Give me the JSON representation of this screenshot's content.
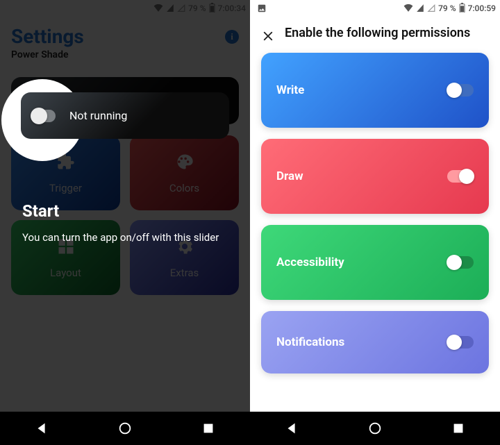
{
  "left": {
    "status": {
      "battery": "79 %",
      "time": "7:00:34"
    },
    "title": "Settings",
    "subtitle": "Power Shade",
    "running_label": "Not running",
    "tiles": {
      "trigger": "Trigger",
      "colors": "Colors",
      "layout": "Layout",
      "extras": "Extras"
    },
    "tutorial": {
      "title": "Start",
      "body": "You can turn the app on/off with this slider"
    }
  },
  "right": {
    "status": {
      "battery": "79 %",
      "time": "7:00:59"
    },
    "header": "Enable the following permissions",
    "perms": {
      "write": {
        "label": "Write",
        "on": false
      },
      "draw": {
        "label": "Draw",
        "on": true
      },
      "accessibility": {
        "label": "Accessibility",
        "on": false
      },
      "notifications": {
        "label": "Notifications",
        "on": false
      }
    }
  }
}
